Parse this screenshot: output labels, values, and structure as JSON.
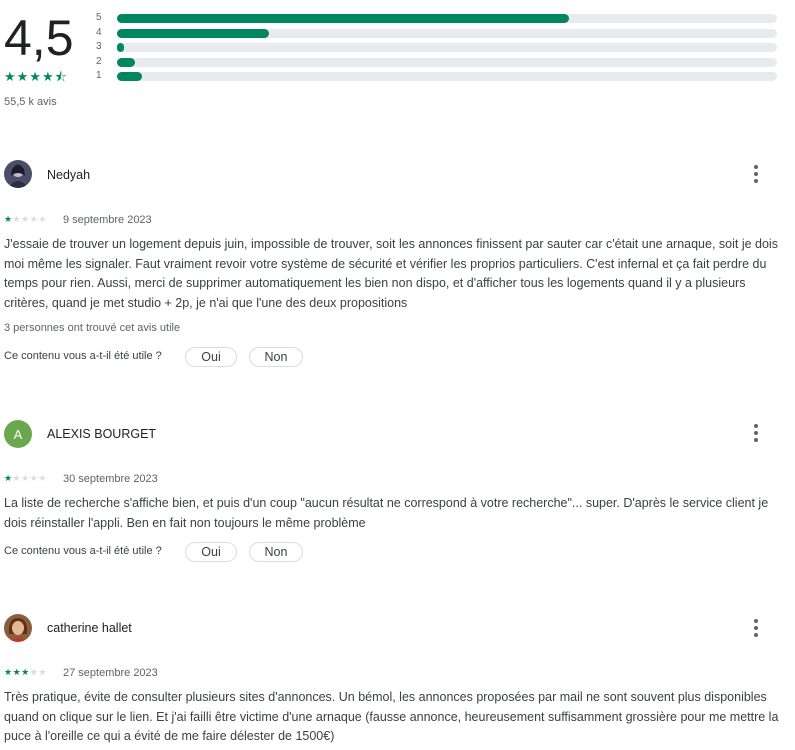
{
  "summary": {
    "score": "4,5",
    "stars": "★★★★⯪",
    "count": "55,5 k avis",
    "bars": [
      {
        "label": "5",
        "fraction": 0.685
      },
      {
        "label": "4",
        "fraction": 0.23
      },
      {
        "label": "3",
        "fraction": 0.01
      },
      {
        "label": "2",
        "fraction": 0.028
      },
      {
        "label": "1",
        "fraction": 0.038
      }
    ],
    "accent": "#01875f"
  },
  "review_question": "Ce contenu vous a-t-il été utile ?",
  "yes_label": "Oui",
  "no_label": "Non",
  "reviews": [
    {
      "author": "Nedyah",
      "rating": 1,
      "date": "9 septembre 2023",
      "text": "J'essaie de trouver un logement depuis juin, impossible de trouver, soit les annonces finissent par sauter car c'était une arnaque, soit je dois moi même les signaler. Faut vraiment revoir votre système de sécurité et vérifier les proprios particuliers. C'est infernal et ça fait perdre du temps pour rien. Aussi, merci de supprimer automatiquement les bien non dispo, et d'afficher tous les logements quand il y a plusieurs critères, quand je met studio + 2p, je n'ai que l'une des deux propositions",
      "helpful": "3 personnes ont trouvé cet avis utile"
    },
    {
      "author": "ALEXIS BOURGET",
      "avatar_letter": "A",
      "rating": 1,
      "date": "30 septembre 2023",
      "text": "La liste de recherche s'affiche bien, et puis d'un coup \"aucun résultat ne correspond à votre recherche\"... super. D'après le service client je dois réinstaller l'appli. Ben en fait non toujours le même problème"
    },
    {
      "author": "catherine hallet",
      "rating": 3,
      "date": "27 septembre 2023",
      "text": "Très pratique, évite de consulter plusieurs sites d'annonces. Un bémol, les annonces proposées par mail ne sont souvent plus disponibles quand on clique sur le lien. Et j'ai failli être victime d'une arnaque (fausse annonce, heureusement suffisamment grossière pour me mettre la puce à l'oreille ce qui a évité de me faire délester de 1500€)"
    }
  ]
}
